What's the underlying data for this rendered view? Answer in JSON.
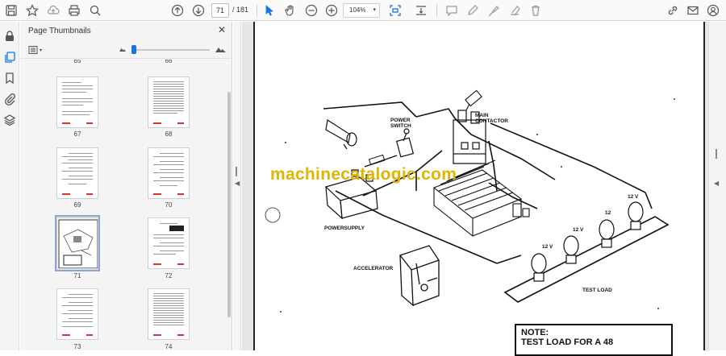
{
  "toolbar": {
    "page_current": "71",
    "page_total": "/  181",
    "zoom": "104%",
    "icons": [
      "save-icon",
      "bookmark-star-icon",
      "upload-icon",
      "print-icon",
      "zoom-search-icon",
      "page-up-icon",
      "page-down-icon",
      "select-cursor-icon",
      "hand-pan-icon",
      "zoom-out-icon",
      "zoom-in-icon",
      "fit-page-icon",
      "scroll-mode-icon",
      "comment-icon",
      "pen-icon",
      "highlighter-icon",
      "clear-icon",
      "delete-icon",
      "share-link-icon",
      "email-icon",
      "account-icon"
    ]
  },
  "rail": {
    "icons": [
      "lock-icon",
      "thumbnails-icon",
      "bookmark-icon",
      "attachment-icon",
      "layers-icon"
    ]
  },
  "panel": {
    "title": "Page Thumbnails",
    "thumbnail_size_fraction": 0.0,
    "top_labels": [
      "65",
      "66"
    ],
    "thumbnails": [
      {
        "label": "67"
      },
      {
        "label": "68"
      },
      {
        "label": "69"
      },
      {
        "label": "70"
      },
      {
        "label": "71",
        "selected": true
      },
      {
        "label": "72"
      },
      {
        "label": "73"
      },
      {
        "label": "74"
      }
    ]
  },
  "document": {
    "watermark": "machinecatalogic.com",
    "labels": {
      "power_switch": "POWER\nSWITCH",
      "main_contactor": "MAIN\nCONTACTOR",
      "power_supply": "POWERSUPPLY",
      "accelerator": "ACCELERATOR",
      "test_load": "TEST LOAD",
      "volt_12v": "12 V",
      "volt_12": "12"
    },
    "note_title": "NOTE:",
    "note_text": "TEST LOAD FOR A 48"
  }
}
